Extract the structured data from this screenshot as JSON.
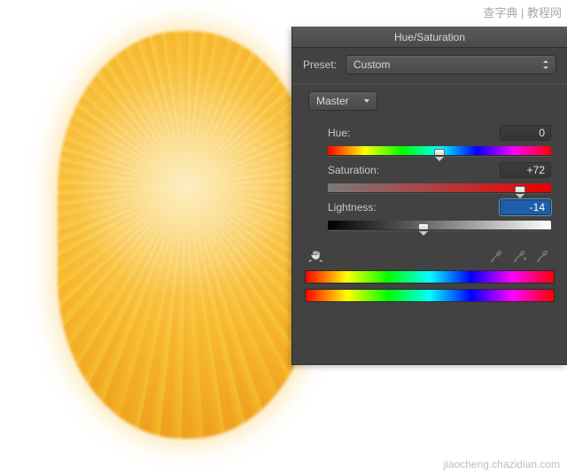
{
  "panel": {
    "title": "Hue/Saturation",
    "preset_label": "Preset:",
    "preset_value": "Custom",
    "channel_value": "Master",
    "sliders": {
      "hue": {
        "label": "Hue:",
        "value": "0",
        "pos": 50
      },
      "saturation": {
        "label": "Saturation:",
        "value": "+72",
        "pos": 86
      },
      "lightness": {
        "label": "Lightness:",
        "value": "-14",
        "pos": 43
      }
    }
  },
  "watermarks": {
    "bottom": "jiaocheng.chazidian.com",
    "top": "查字典 | 教程网"
  }
}
